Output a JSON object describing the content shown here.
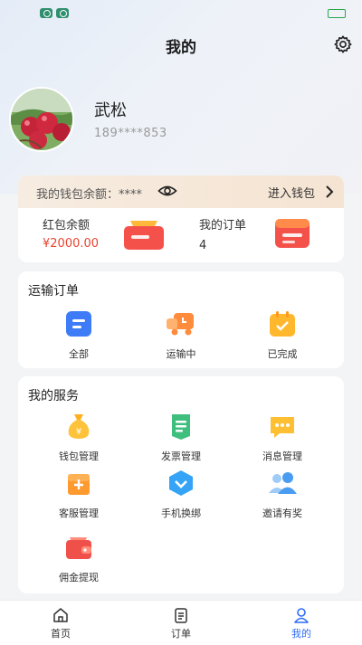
{
  "header": {
    "title": "我的"
  },
  "profile": {
    "name": "武松",
    "phone": "189****853"
  },
  "wallet": {
    "balance_label": "我的钱包余额：****",
    "enter_label": "进入钱包",
    "redpacket_label": "红包余额",
    "redpacket_value": "¥2000.00",
    "orders_label": "我的订单",
    "orders_value": "4"
  },
  "transport": {
    "title": "运输订单",
    "items": [
      {
        "label": "全部",
        "icon": "list-icon"
      },
      {
        "label": "运输中",
        "icon": "truck-icon"
      },
      {
        "label": "已完成",
        "icon": "completed-icon"
      }
    ]
  },
  "services": {
    "title": "我的服务",
    "items": [
      {
        "label": "钱包管理",
        "icon": "money-bag-icon"
      },
      {
        "label": "发票管理",
        "icon": "invoice-icon"
      },
      {
        "label": "消息管理",
        "icon": "message-icon"
      },
      {
        "label": "客服管理",
        "icon": "customer-service-icon"
      },
      {
        "label": "手机换绑",
        "icon": "phone-rebind-icon"
      },
      {
        "label": "邀请有奖",
        "icon": "invite-icon"
      },
      {
        "label": "佣金提现",
        "icon": "wallet-withdraw-icon"
      }
    ]
  },
  "tabbar": {
    "items": [
      {
        "label": "首页",
        "icon": "home-icon"
      },
      {
        "label": "订单",
        "icon": "order-icon"
      },
      {
        "label": "我的",
        "icon": "profile-icon",
        "active": true
      }
    ]
  },
  "colors": {
    "accent": "#2f6cf6",
    "price": "#e8452f",
    "wallet_strip": "#f5e4d2"
  }
}
